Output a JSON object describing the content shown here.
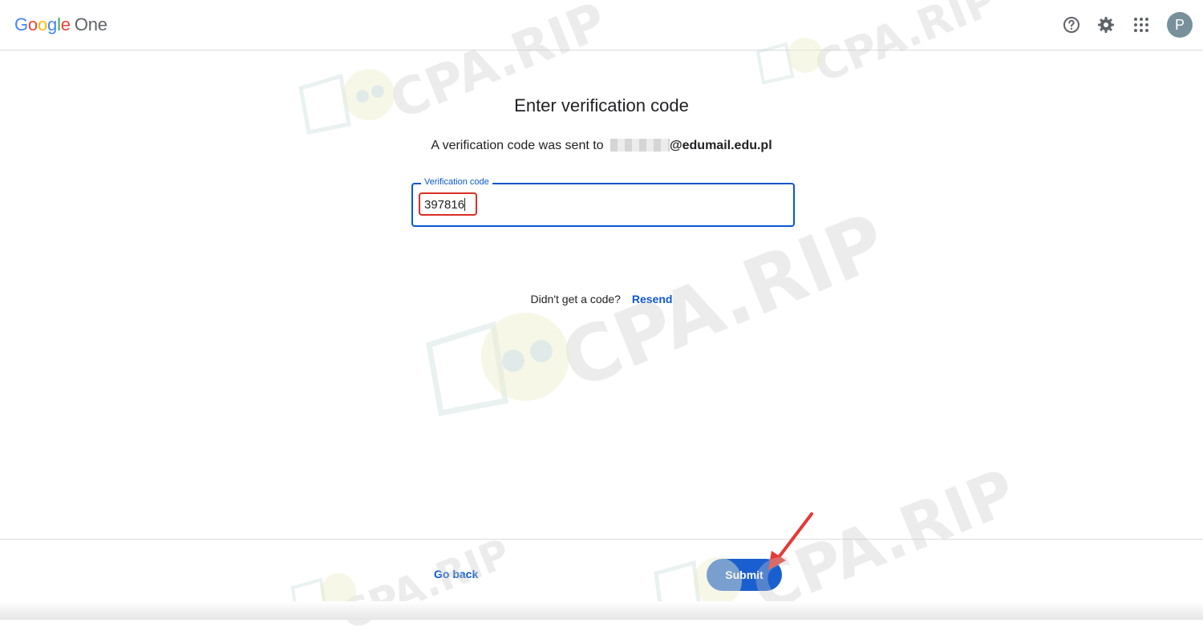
{
  "header": {
    "logo_google": "Google",
    "logo_product": "One",
    "help_icon": "help-circle-icon",
    "settings_icon": "gear-icon",
    "apps_icon": "apps-grid-icon",
    "avatar_initial": "P"
  },
  "main": {
    "title": "Enter verification code",
    "sent_prefix": "A verification code was sent to",
    "sent_email": "@edumail.edu.pl",
    "field": {
      "label": "Verification code",
      "value": "397816"
    },
    "resend_prompt": "Didn't get a code?",
    "resend_label": "Resend"
  },
  "footer": {
    "go_back_label": "Go back",
    "submit_label": "Submit"
  },
  "watermark": {
    "text": "CPA.RIP"
  },
  "colors": {
    "google_blue": "#4285F4",
    "google_red": "#EA4335",
    "google_yellow": "#FBBC05",
    "google_green": "#34A853",
    "accent": "#0b57d0",
    "avatar_bg": "#78909c",
    "highlight_red": "#d93025",
    "arrow_red": "#e53935"
  }
}
